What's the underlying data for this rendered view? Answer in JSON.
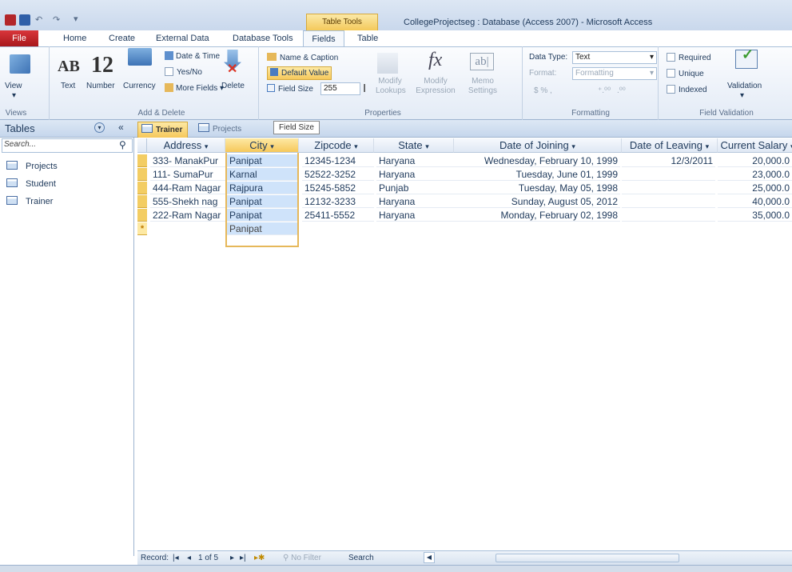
{
  "window": {
    "title": "CollegeProjectseg : Database (Access 2007) - Microsoft Access",
    "contextual_tab": "Table Tools"
  },
  "ribbon_tabs": [
    "File",
    "Home",
    "Create",
    "External Data",
    "Database Tools",
    "Fields",
    "Table"
  ],
  "ribbon": {
    "views": {
      "view_label": "View",
      "group_label": "Views"
    },
    "add_delete": {
      "text_label": "Text",
      "text_glyph": "AB",
      "number_label": "Number",
      "number_glyph": "12",
      "currency_label": "Currency",
      "date_time": "Date & Time",
      "yes_no": "Yes/No",
      "more_fields": "More Fields",
      "delete_label": "Delete",
      "group_label": "Add & Delete"
    },
    "properties": {
      "name_caption": "Name & Caption",
      "default_value": "Default Value",
      "field_size_label": "Field Size",
      "field_size_value": "255",
      "modify_lookups": [
        "Modify",
        "Lookups"
      ],
      "modify_expression": [
        "Modify",
        "Expression"
      ],
      "memo_settings": [
        "Memo",
        "Settings"
      ],
      "group_label": "Properties"
    },
    "formatting": {
      "data_type_label": "Data Type:",
      "data_type_value": "Text",
      "format_label": "Format:",
      "format_value": "Formatting",
      "currency_symbols": "$  %  ,",
      "group_label": "Formatting"
    },
    "validation": {
      "required": "Required",
      "unique": "Unique",
      "indexed": "Indexed",
      "validation_label": "Validation",
      "group_label": "Field Validation"
    }
  },
  "nav": {
    "title": "Tables",
    "search_placeholder": "Search...",
    "items": [
      "Projects",
      "Student",
      "Trainer"
    ]
  },
  "doc_tabs": [
    "Trainer",
    "Projects"
  ],
  "tooltip": "Field Size",
  "table": {
    "columns": [
      "Address",
      "City",
      "Zipcode",
      "State",
      "Date of Joining",
      "Date of Leaving",
      "Current Salary"
    ],
    "rows": [
      [
        "333- ManakPur",
        "Panipat",
        "12345-1234",
        "Haryana",
        "Wednesday, February 10, 1999",
        "12/3/2011",
        "20,000.0"
      ],
      [
        "111- SumaPur",
        "Karnal",
        "52522-3252",
        "Haryana",
        "Tuesday, June 01, 1999",
        "",
        "23,000.0"
      ],
      [
        "444-Ram Nagar",
        "Rajpura",
        "15245-5852",
        "Punjab",
        "Tuesday, May 05, 1998",
        "",
        "25,000.0"
      ],
      [
        "555-Shekh nag",
        "Panipat",
        "12132-3233",
        "Haryana",
        "Sunday, August 05, 2012",
        "",
        "40,000.0"
      ],
      [
        "222-Ram Nagar",
        "Panipat",
        "25411-5552",
        "Haryana",
        "Monday, February 02, 1998",
        "",
        "35,000.0"
      ]
    ],
    "new_row_city": "Panipat",
    "new_row_marker": "*"
  },
  "record_nav": {
    "label": "Record:",
    "position": "1 of 5",
    "filter": "No Filter",
    "search": "Search"
  },
  "colors": {
    "accent": "#f3cd63",
    "selection": "#cfe3fa",
    "file_tab": "#c4262b"
  }
}
